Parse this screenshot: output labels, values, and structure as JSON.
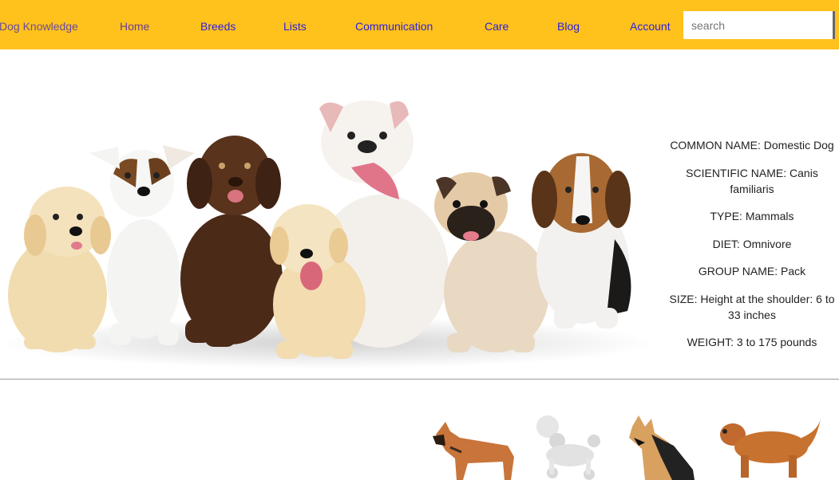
{
  "nav": {
    "brand": "Dog Knowledge",
    "items": [
      "Home",
      "Breeds",
      "Lists",
      "Communication",
      "Care",
      "Blog",
      "Account"
    ],
    "search_placeholder": "search",
    "colors": {
      "bar": "#ffc11c",
      "visited_link": "#6b3d91",
      "link": "#2b1ee0"
    }
  },
  "facts": {
    "common_name": "COMMON NAME: Domestic Dog",
    "scientific_name": "SCIENTIFIC NAME: Canis familiaris",
    "type": "TYPE: Mammals",
    "diet": "DIET: Omnivore",
    "group_name": "GROUP NAME: Pack",
    "size": "SIZE: Height at the shoulder: 6 to 33 inches",
    "weight": "WEIGHT: 3 to 175 pounds"
  },
  "icons": {
    "hero": "seven-puppies-image",
    "breeds": [
      "boxer-icon",
      "poodle-icon",
      "german-shepherd-icon",
      "golden-retriever-icon"
    ]
  }
}
